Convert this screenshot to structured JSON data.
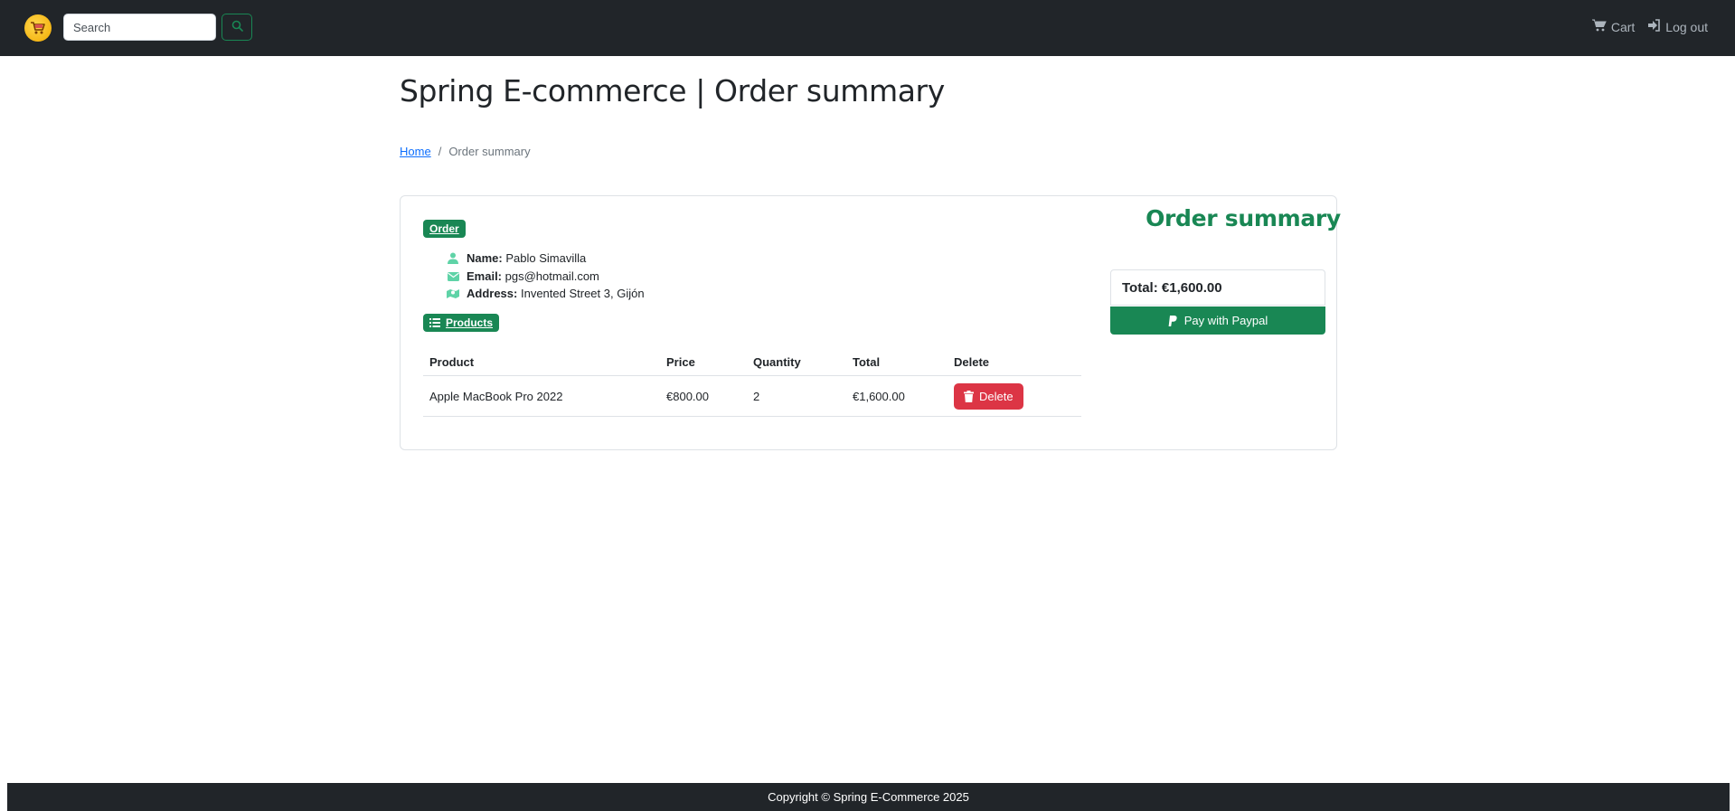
{
  "nav": {
    "logo_icon": "shopping-cart-logo-icon",
    "search_placeholder": "Search",
    "search_icon": "search-icon",
    "cart_label": "Cart",
    "logout_label": "Log out"
  },
  "page": {
    "title": "Spring E-commerce | Order summary"
  },
  "breadcrumb": {
    "home": "Home",
    "separator": "/",
    "current": "Order summary"
  },
  "order": {
    "badge": "Order",
    "name_label": "Name:",
    "name_value": "Pablo Simavilla",
    "email_label": "Email:",
    "email_value": "pgs@hotmail.com",
    "address_label": "Address:",
    "address_value": "Invented Street 3, Gijón"
  },
  "products": {
    "badge": "Products",
    "headers": [
      "Product",
      "Price",
      "Quantity",
      "Total",
      "Delete"
    ],
    "rows": [
      {
        "product": "Apple MacBook Pro 2022",
        "price": "€800.00",
        "quantity": "2",
        "total": "€1,600.00",
        "delete_label": "Delete"
      }
    ]
  },
  "summary": {
    "heading": "Order summary",
    "total": "Total: €1,600.00",
    "pay_label": "Pay with Paypal"
  },
  "footer": {
    "copyright": "Copyright © Spring E-Commerce 2025"
  },
  "colors": {
    "navbar": "#212529",
    "success": "#198754",
    "danger": "#dc3545",
    "link": "#0d6efd",
    "info_icon": "#5fd3a7"
  }
}
